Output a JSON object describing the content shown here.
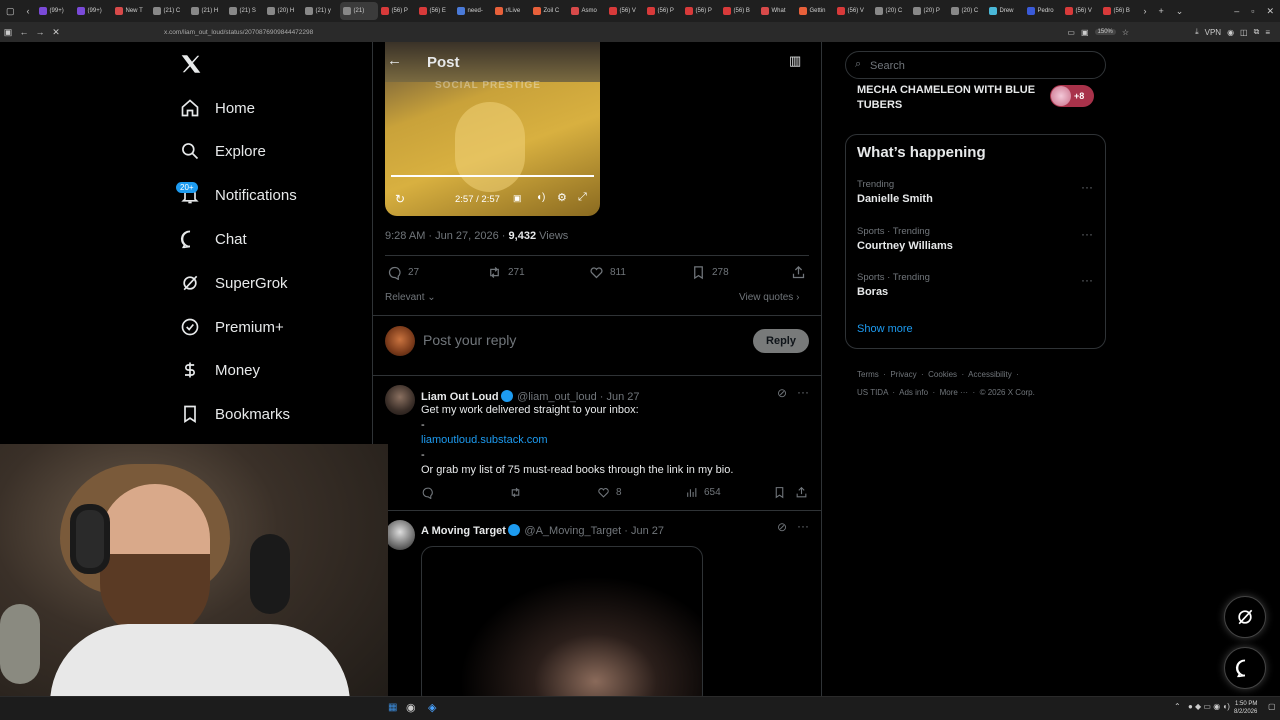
{
  "browser": {
    "tabs": [
      "(99+)",
      "(99+)",
      "New T",
      "(21) C",
      "(21) H",
      "(21) S",
      "(20) H",
      "(21) y",
      "(21)",
      "(56) P",
      "(56) E",
      "need-",
      "r/Live",
      "Zoil C",
      "Asmo",
      "(56) V",
      "(56) P",
      "(56) P",
      "(56) B",
      "What",
      "Gettin",
      "(56) V",
      "(20) C",
      "(20) P",
      "(20) C",
      "Drew",
      "Pedro",
      "(56) V",
      "(56) B"
    ],
    "url": "x.com/liam_out_loud/status/2070876909844472298",
    "zoom": "150%",
    "vpn": "VPN"
  },
  "nav": {
    "home": "Home",
    "explore": "Explore",
    "notifications": "Notifications",
    "notifications_badge": "20+",
    "chat": "Chat",
    "supergrok": "SuperGrok",
    "premium": "Premium+",
    "money": "Money",
    "bookmarks": "Bookmarks"
  },
  "post": {
    "header_title": "Post",
    "video_overlay_text": "SOCIAL PRESTIGE",
    "video_time": "2:57 / 2:57",
    "video_progress": 1.0,
    "timestamp": "9:28 AM · Jun 27, 2026 · ",
    "views_count": "9,432",
    "views_label": " Views",
    "replies": "27",
    "reposts": "271",
    "likes": "811",
    "bookmarks": "278",
    "sort_label": "Relevant",
    "view_quotes": "View quotes",
    "reply_placeholder": "Post your reply",
    "reply_button": "Reply"
  },
  "replies": [
    {
      "name": "Liam Out Loud",
      "handle": "@liam_out_loud · Jun 27",
      "line1": "Get my work delivered straight to your inbox:",
      "line2": "-",
      "link": "liamoutloud.substack.com",
      "line3": "-",
      "line4": "Or grab my list of 75 must-read books through the link in my bio.",
      "likes": "8",
      "views": "654"
    },
    {
      "name": "A Moving Target",
      "handle": "@A_Moving_Target · Jun 27"
    }
  ],
  "right": {
    "search_placeholder": "Search",
    "community_title": "MECHA CHAMELEON WITH BLUE TUBERS",
    "community_count": "+8",
    "happening_title": "What’s happening",
    "trends": [
      {
        "category": "Trending",
        "name": "Danielle Smith"
      },
      {
        "category": "Sports · Trending",
        "name": "Courtney Williams"
      },
      {
        "category": "Sports · Trending",
        "name": "Boras"
      }
    ],
    "show_more": "Show more",
    "footer": [
      "Terms",
      "Privacy",
      "Cookies",
      "Accessibility",
      "US TIDA",
      "Ads info",
      "More ···",
      "© 2026 X Corp."
    ]
  },
  "taskbar": {
    "time": "1:50 PM",
    "date": "8/2/2026"
  },
  "colors": {
    "accent": "#1d9bf0",
    "background": "#000000",
    "border": "#2f3336",
    "muted": "#71767b"
  }
}
